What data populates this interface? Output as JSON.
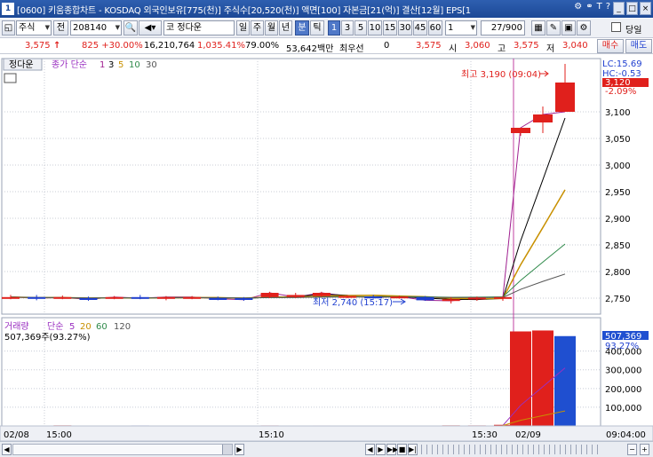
{
  "titlebar": {
    "num": "1",
    "text": "[0600] 키움종합차트 - KOSDAQ 외국인보유[775(천)] 주식수[20,520(천)] 액면[100] 자본금[21(억)] 결산[12월] EPS[1",
    "controls": [
      "_",
      "□",
      "×"
    ]
  },
  "toolbar": {
    "market": "주식",
    "jeon": "전",
    "code": "208140",
    "market_tag": "코",
    "stock_name": "정다운",
    "period_buttons": [
      "일",
      "주",
      "월",
      "년",
      "분",
      "틱"
    ],
    "interval_buttons": [
      "1",
      "3",
      "5",
      "10",
      "15",
      "30",
      "45",
      "60"
    ],
    "interval_value": "1",
    "count": "27/900",
    "checkbox_label": "당일"
  },
  "quote": {
    "price": "3,575",
    "arrow": "↑",
    "change": "825 +30.00%",
    "volume": "16,210,764",
    "volume_ratio": "1,035.41%",
    "ratio2": "79.00%",
    "amount": "53,642백만",
    "best_label": "최우선",
    "best_value": "0",
    "best_price": "3,575",
    "open_label": "시",
    "open_value": "3,060",
    "high_label": "고",
    "high_value": "3,575",
    "low_label": "저",
    "low_value": "3,040",
    "buy_button": "매수",
    "sell_button": "매도"
  },
  "price_panel": {
    "title": "정다운",
    "legend": [
      {
        "label": "종가 단순",
        "color": "#9a2fc0"
      },
      {
        "label": "1",
        "color": "#a02090"
      },
      {
        "label": "3",
        "color": "#000000"
      },
      {
        "label": "5",
        "color": "#c89000"
      },
      {
        "label": "10",
        "color": "#2f8a4a"
      },
      {
        "label": "30",
        "color": "#555555"
      }
    ],
    "lc": "LC:15.69",
    "hc": "HC:-0.53",
    "current_price_label": "3,120",
    "current_pct": "-2.09%",
    "high_annotation": "최고 3,190 (09:04)",
    "low_annotation": "최저 2,740 (15:17)",
    "yticks": [
      "3,100",
      "3,050",
      "3,000",
      "2,950",
      "2,900",
      "2,850",
      "2,800",
      "2,750"
    ]
  },
  "volume_panel": {
    "title": "거래량",
    "legend": [
      {
        "label": "단순",
        "color": "#9a2fc0"
      },
      {
        "label": "5",
        "color": "#9a2fc0"
      },
      {
        "label": "20",
        "color": "#c89000"
      },
      {
        "label": "60",
        "color": "#2f8a4a"
      },
      {
        "label": "120",
        "color": "#555555"
      }
    ],
    "current_volume": "507,369주(93.27%)",
    "current_volume_label": "507,369",
    "current_pct": "93.27%",
    "yticks": [
      "400,000",
      "300,000",
      "200,000",
      "100,000"
    ]
  },
  "xaxis": {
    "labels": [
      "02/08",
      "15:00",
      "15:10",
      "15:30",
      "02/09"
    ],
    "right_time": "09:04:00"
  },
  "chart_data": {
    "type": "candlestick",
    "ylim": [
      2720,
      3200
    ],
    "price_candles": [
      {
        "o": 2752,
        "h": 2756,
        "l": 2748,
        "c": 2752,
        "color": "red"
      },
      {
        "o": 2752,
        "h": 2756,
        "l": 2746,
        "c": 2750,
        "color": "blue"
      },
      {
        "o": 2752,
        "h": 2755,
        "l": 2748,
        "c": 2751,
        "color": "red"
      },
      {
        "o": 2750,
        "h": 2753,
        "l": 2745,
        "c": 2748,
        "color": "blue"
      },
      {
        "o": 2750,
        "h": 2754,
        "l": 2748,
        "c": 2752,
        "color": "red"
      },
      {
        "o": 2752,
        "h": 2756,
        "l": 2748,
        "c": 2750,
        "color": "blue"
      },
      {
        "o": 2750,
        "h": 2754,
        "l": 2746,
        "c": 2752,
        "color": "red"
      },
      {
        "o": 2751,
        "h": 2754,
        "l": 2748,
        "c": 2752,
        "color": "red"
      },
      {
        "o": 2750,
        "h": 2753,
        "l": 2746,
        "c": 2749,
        "color": "blue"
      },
      {
        "o": 2750,
        "h": 2752,
        "l": 2745,
        "c": 2747,
        "color": "blue"
      },
      {
        "o": 2752,
        "h": 2762,
        "l": 2750,
        "c": 2760,
        "color": "red"
      },
      {
        "o": 2756,
        "h": 2760,
        "l": 2750,
        "c": 2752,
        "color": "red"
      },
      {
        "o": 2754,
        "h": 2762,
        "l": 2752,
        "c": 2760,
        "color": "red"
      },
      {
        "o": 2753,
        "h": 2756,
        "l": 2750,
        "c": 2754,
        "color": "red"
      },
      {
        "o": 2753,
        "h": 2756,
        "l": 2749,
        "c": 2751,
        "color": "blue"
      },
      {
        "o": 2752,
        "h": 2755,
        "l": 2749,
        "c": 2753,
        "color": "red"
      },
      {
        "o": 2752,
        "h": 2754,
        "l": 2745,
        "c": 2746,
        "color": "blue"
      },
      {
        "o": 2748,
        "h": 2752,
        "l": 2740,
        "c": 2745,
        "color": "red"
      },
      {
        "o": 2750,
        "h": 2753,
        "l": 2745,
        "c": 2751,
        "color": "red"
      },
      {
        "o": 2751,
        "h": 2754,
        "l": 2745,
        "c": 2752,
        "color": "red"
      },
      {
        "o": 3060,
        "h": 3070,
        "l": 3055,
        "c": 3070,
        "color": "red"
      },
      {
        "o": 3080,
        "h": 3110,
        "l": 3060,
        "c": 3095,
        "color": "red"
      },
      {
        "o": 3155,
        "h": 3190,
        "l": 3100,
        "c": 3100,
        "color": "red"
      }
    ],
    "volume_bars": [
      2000,
      1500,
      3000,
      2200,
      1800,
      2500,
      2000,
      1700,
      2200,
      1900,
      2600,
      2100,
      2400,
      1800,
      2200,
      2000,
      2300,
      3000,
      2800,
      6000,
      505000,
      510000,
      480000
    ]
  },
  "scroll": {
    "buttons": [
      "◀",
      "▶",
      "▶▶",
      "■",
      "▶|"
    ],
    "zoom_buttons": [
      "−",
      "+"
    ]
  }
}
